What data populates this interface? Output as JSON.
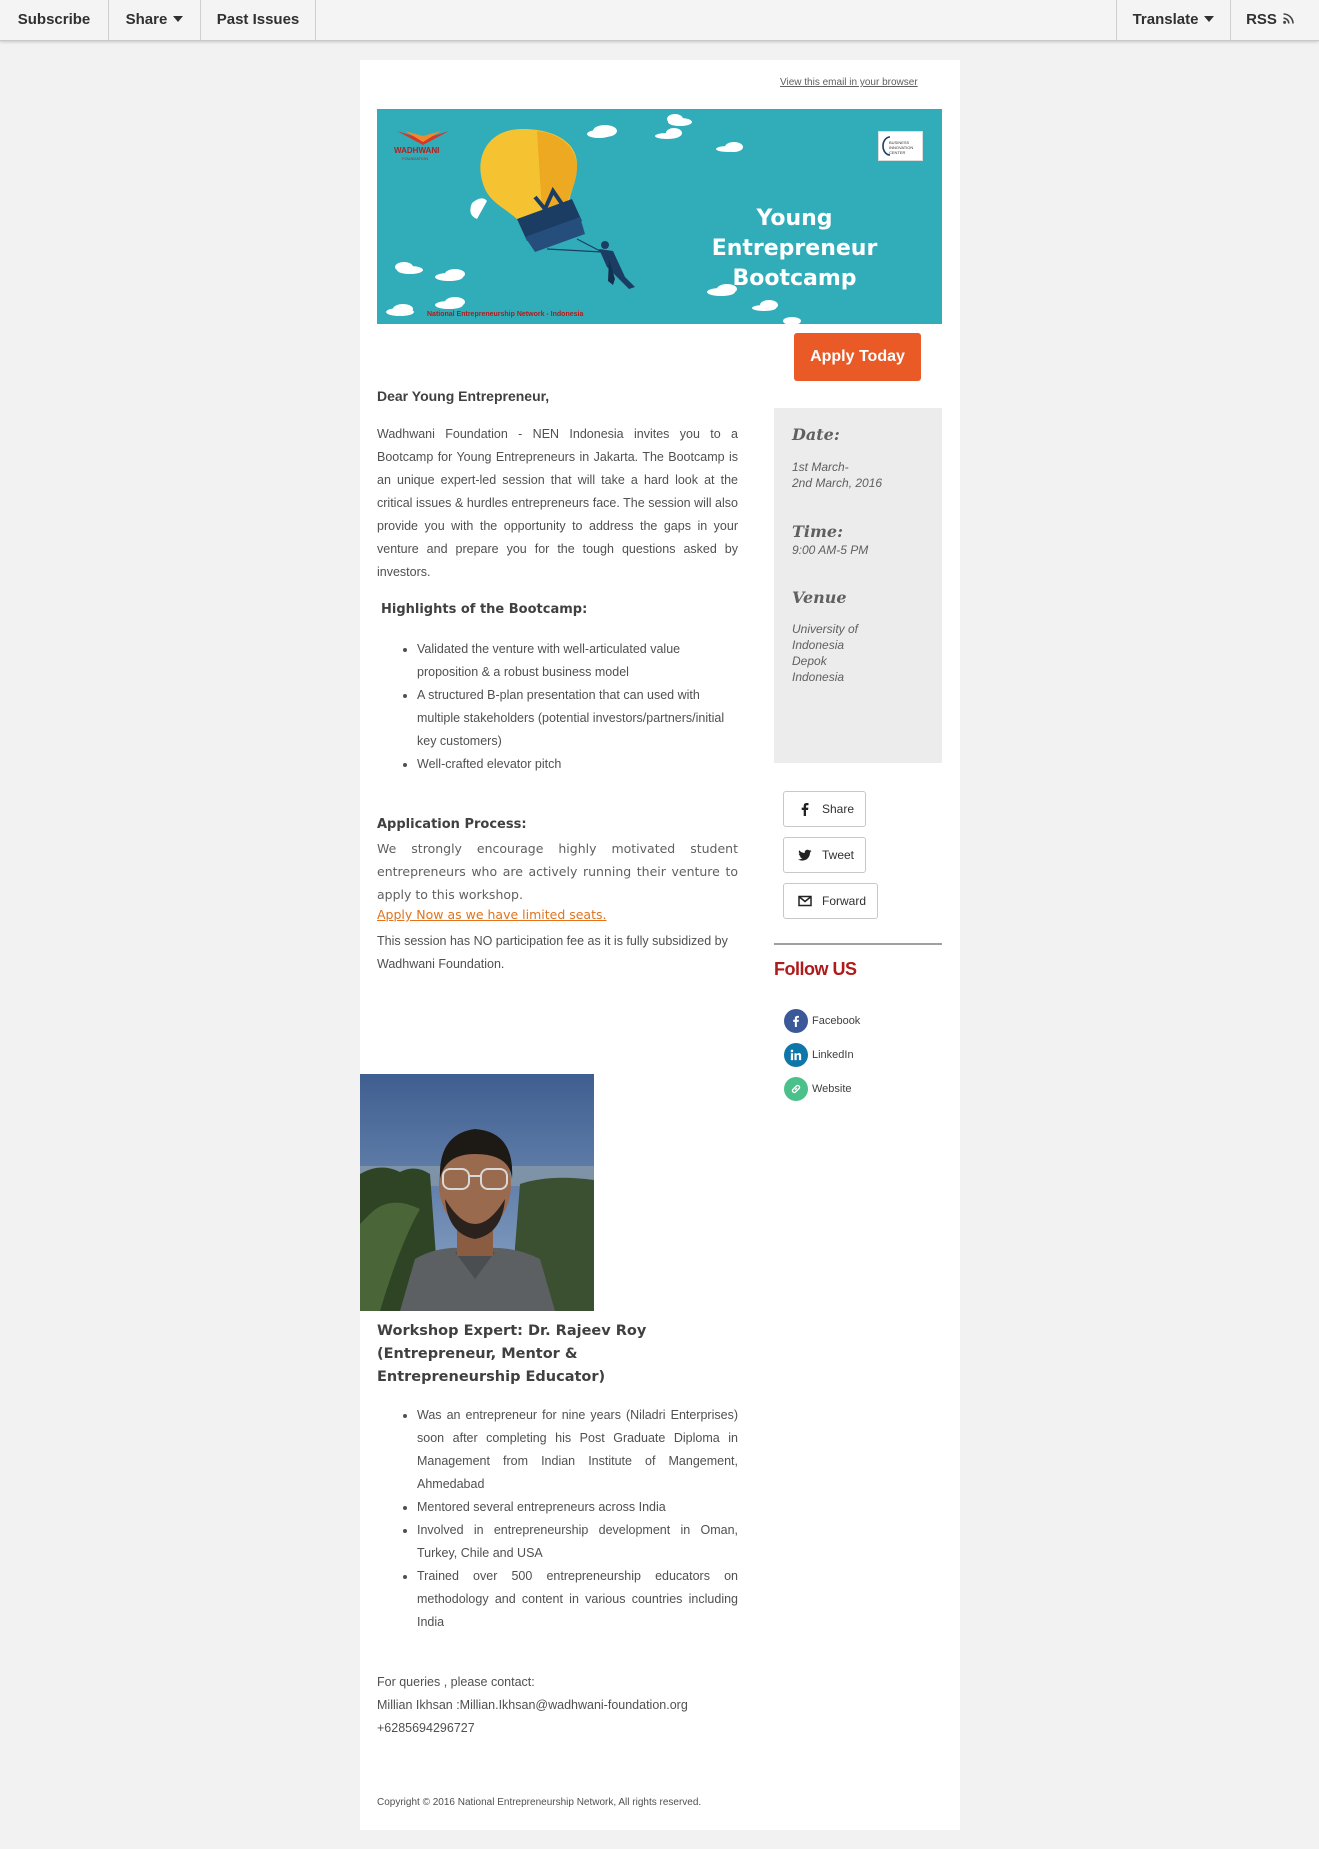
{
  "nav": {
    "subscribe": "Subscribe",
    "share": "Share",
    "past_issues": "Past Issues",
    "translate": "Translate",
    "rss": "RSS"
  },
  "header": {
    "view_browser": "View this email in your browser"
  },
  "banner": {
    "logo": "WADHWANI",
    "logo_sub": "FOUNDATION",
    "partner_logo": "BUSINESS INNOVATION CENTER",
    "title": "Young Entrepreneur Bootcamp",
    "footer": "National Entrepreneurship Network - Indonesia"
  },
  "apply_button": "Apply Today",
  "body": {
    "greeting": "Dear Young Entrepreneur,",
    "intro": "Wadhwani Foundation - NEN Indonesia invites you to a Bootcamp for Young Entrepreneurs in Jakarta. The Bootcamp is an unique expert-led session that will take a hard look at the critical issues & hurdles entrepreneurs face. The session will also provide you with the opportunity to address the gaps in your venture and prepare you for the tough questions asked by investors.",
    "highlights_title": "Highlights of the Bootcamp:",
    "highlights": [
      "Validated the venture with well-articulated value proposition & a robust business model",
      "A structured B-plan presentation that can used with multiple stakeholders (potential investors/partners/initial key customers)",
      "Well-crafted elevator pitch"
    ],
    "application_title": "Application Process:",
    "application_text": "We strongly encourage highly motivated student entrepreneurs who are actively running their venture to apply to this workshop.",
    "application_link": "Apply Now as we have limited seats.",
    "application_fee": "This session has NO participation fee as it is fully subsidized by Wadhwani Foundation."
  },
  "event": {
    "date_label": "Date:",
    "date_value": "1st March-\n2nd March, 2016",
    "time_label": "Time:",
    "time_value": "9:00 AM-5 PM",
    "venue_label": "Venue",
    "venue_value": "University of\nIndonesia\nDepok\nIndonesia"
  },
  "share_buttons": {
    "share": "Share",
    "tweet": "Tweet",
    "forward": "Forward"
  },
  "follow": {
    "title": "Follow US",
    "facebook": "Facebook",
    "linkedin": "LinkedIn",
    "website": "Website",
    "colors": {
      "facebook": "#3b5998",
      "linkedin": "#0e76a8",
      "website": "#4cc08a"
    }
  },
  "expert": {
    "title": "Workshop Expert: Dr. Rajeev Roy (Entrepreneur, Mentor & Entrepreneurship Educator)",
    "points": [
      "Was an entrepreneur for nine years (Niladri Enterprises) soon after completing his Post Graduate Diploma in Management from Indian Institute of Mangement, Ahmedabad",
      "Mentored several entrepreneurs across India",
      "Involved in entrepreneurship development in Oman, Turkey, Chile and USA",
      "Trained over 500 entrepreneurship educators on methodology and content in various countries including India"
    ]
  },
  "contact": {
    "line1": "For queries , please contact:",
    "line2": "Millian Ikhsan :Millian.Ikhsan@wadhwani-foundation.org",
    "line3": "+6285694296727"
  },
  "footer": {
    "copyright": "Copyright © 2016 National Entrepreneurship Network, All rights reserved."
  },
  "colors": {
    "accent": "#ea5a26",
    "banner_bg": "#31adb9",
    "follow_title": "#b01a1a",
    "link": "#e0731c"
  }
}
